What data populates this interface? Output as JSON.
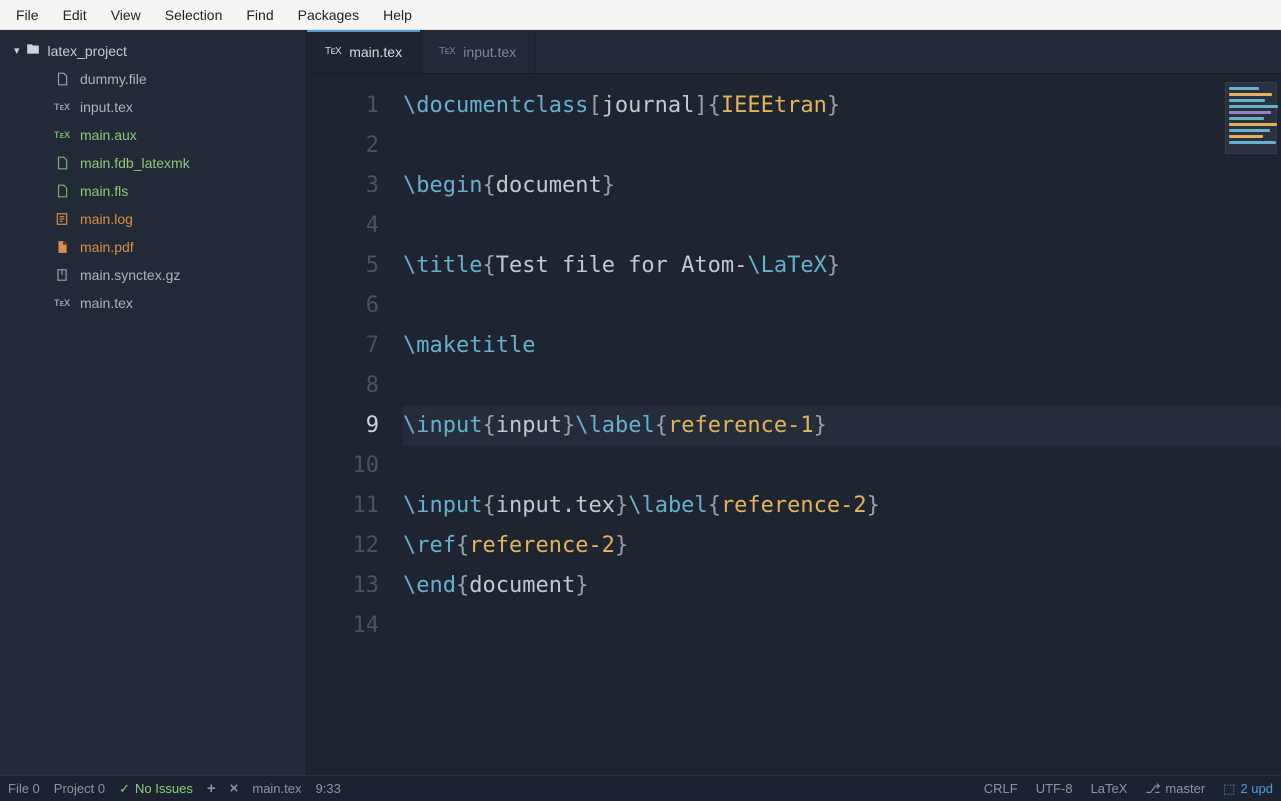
{
  "menubar": [
    "File",
    "Edit",
    "View",
    "Selection",
    "Find",
    "Packages",
    "Help"
  ],
  "sidebar": {
    "root": "latex_project",
    "files": [
      {
        "name": "dummy.file",
        "icon": "doc",
        "color": "default"
      },
      {
        "name": "input.tex",
        "icon": "tex",
        "color": "default"
      },
      {
        "name": "main.aux",
        "icon": "tex",
        "color": "green"
      },
      {
        "name": "main.fdb_latexmk",
        "icon": "doc",
        "color": "green"
      },
      {
        "name": "main.fls",
        "icon": "doc",
        "color": "green"
      },
      {
        "name": "main.log",
        "icon": "log",
        "color": "orange"
      },
      {
        "name": "main.pdf",
        "icon": "pdf",
        "color": "orange"
      },
      {
        "name": "main.synctex.gz",
        "icon": "zip",
        "color": "default"
      },
      {
        "name": "main.tex",
        "icon": "tex",
        "color": "default"
      }
    ]
  },
  "tabs": [
    {
      "label": "main.tex",
      "active": true
    },
    {
      "label": "input.tex",
      "active": false
    }
  ],
  "editor": {
    "current_line": 9,
    "lines": [
      {
        "n": 1,
        "tokens": [
          {
            "t": "cmd",
            "v": "\\documentclass"
          },
          {
            "t": "bracket",
            "v": "["
          },
          {
            "t": "arg",
            "v": "journal"
          },
          {
            "t": "bracket",
            "v": "]"
          },
          {
            "t": "brace",
            "v": "{"
          },
          {
            "t": "class",
            "v": "IEEEtran"
          },
          {
            "t": "brace",
            "v": "}"
          }
        ]
      },
      {
        "n": 2,
        "tokens": []
      },
      {
        "n": 3,
        "tokens": [
          {
            "t": "cmd",
            "v": "\\begin"
          },
          {
            "t": "brace",
            "v": "{"
          },
          {
            "t": "env",
            "v": "document"
          },
          {
            "t": "brace",
            "v": "}"
          }
        ]
      },
      {
        "n": 4,
        "tokens": []
      },
      {
        "n": 5,
        "tokens": [
          {
            "t": "cmd",
            "v": "\\title"
          },
          {
            "t": "brace",
            "v": "{"
          },
          {
            "t": "text",
            "v": "Test file for Atom-"
          },
          {
            "t": "cmd",
            "v": "\\LaTeX"
          },
          {
            "t": "brace",
            "v": "}"
          }
        ]
      },
      {
        "n": 6,
        "tokens": []
      },
      {
        "n": 7,
        "tokens": [
          {
            "t": "cmd",
            "v": "\\maketitle"
          }
        ]
      },
      {
        "n": 8,
        "tokens": []
      },
      {
        "n": 9,
        "tokens": [
          {
            "t": "cmd",
            "v": "\\input"
          },
          {
            "t": "brace",
            "v": "{"
          },
          {
            "t": "arg",
            "v": "input"
          },
          {
            "t": "brace",
            "v": "}"
          },
          {
            "t": "cmd",
            "v": "\\label"
          },
          {
            "t": "brace",
            "v": "{"
          },
          {
            "t": "ref",
            "v": "reference-1"
          },
          {
            "t": "brace",
            "v": "}"
          }
        ]
      },
      {
        "n": 10,
        "tokens": []
      },
      {
        "n": 11,
        "tokens": [
          {
            "t": "cmd",
            "v": "\\input"
          },
          {
            "t": "brace",
            "v": "{"
          },
          {
            "t": "arg",
            "v": "input.tex"
          },
          {
            "t": "brace",
            "v": "}"
          },
          {
            "t": "cmd",
            "v": "\\label"
          },
          {
            "t": "brace",
            "v": "{"
          },
          {
            "t": "ref",
            "v": "reference-2"
          },
          {
            "t": "brace",
            "v": "}"
          }
        ]
      },
      {
        "n": 12,
        "tokens": [
          {
            "t": "cmd",
            "v": "\\ref"
          },
          {
            "t": "brace",
            "v": "{"
          },
          {
            "t": "ref",
            "v": "reference-2"
          },
          {
            "t": "brace",
            "v": "}"
          }
        ]
      },
      {
        "n": 13,
        "tokens": [
          {
            "t": "cmd",
            "v": "\\end"
          },
          {
            "t": "brace",
            "v": "{"
          },
          {
            "t": "env",
            "v": "document"
          },
          {
            "t": "brace",
            "v": "}"
          }
        ]
      },
      {
        "n": 14,
        "tokens": []
      }
    ]
  },
  "statusbar": {
    "file_count": "File 0",
    "project_count": "Project 0",
    "issues": "No Issues",
    "filename": "main.tex",
    "cursor": "9:33",
    "line_ending": "CRLF",
    "encoding": "UTF-8",
    "grammar": "LaTeX",
    "branch": "master",
    "updates": "2 upd"
  },
  "minimap_colors": [
    "#66b0c9",
    "#e3b35a",
    "#66b0c9",
    "#66b0c9",
    "#9b7fc9",
    "#66b0c9",
    "#e3b35a",
    "#66b0c9",
    "#e3b35a",
    "#66b0c9"
  ]
}
